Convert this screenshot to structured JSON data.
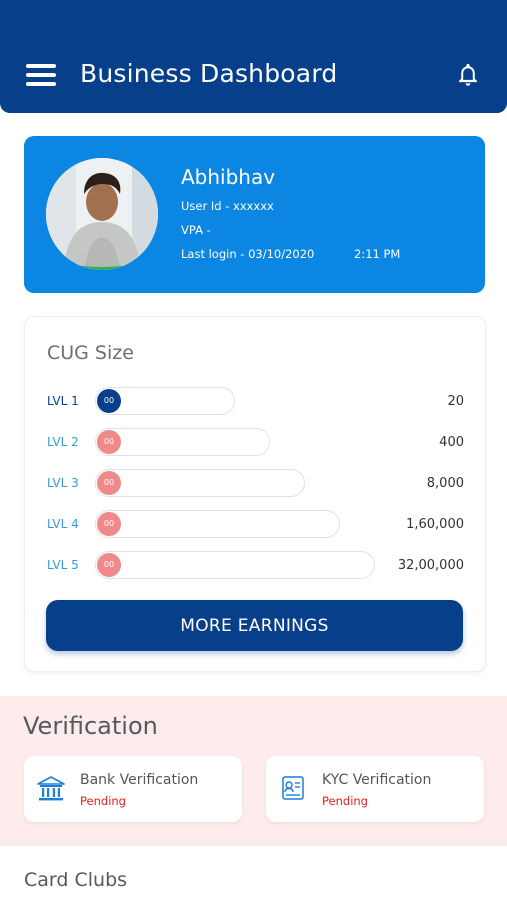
{
  "header": {
    "title": "Business Dashboard",
    "menu_icon": "hamburger-menu-icon",
    "bell_icon": "bell-icon"
  },
  "profile": {
    "name": "Abhibhav",
    "user_id": "User Id - xxxxxx",
    "vpa": "VPA -",
    "last_login": "Last login - 03/10/2020",
    "last_login_time": "2:11 PM"
  },
  "cug": {
    "title": "CUG Size",
    "levels": [
      {
        "label": "LVL 1",
        "knob": "00",
        "value": "20"
      },
      {
        "label": "LVL 2",
        "knob": "00",
        "value": "400"
      },
      {
        "label": "LVL 3",
        "knob": "00",
        "value": "8,000"
      },
      {
        "label": "LVL 4",
        "knob": "00",
        "value": "1,60,000"
      },
      {
        "label": "LVL 5",
        "knob": "00",
        "value": "32,00,000"
      }
    ],
    "button_label": "MORE EARNINGS"
  },
  "verification": {
    "title": "Verification",
    "bank": {
      "label": "Bank Verification",
      "status": "Pending",
      "icon": "bank-icon"
    },
    "kyc": {
      "label": "KYC Verification",
      "status": "Pending",
      "icon": "kyc-document-icon"
    }
  },
  "card_clubs": {
    "title": "Card Clubs"
  },
  "colors": {
    "primary": "#083f8a",
    "profile_card": "#0b86e3",
    "pending": "#e02020",
    "knob_inactive": "#f08a8a",
    "verification_bg": "#fdeceb"
  }
}
